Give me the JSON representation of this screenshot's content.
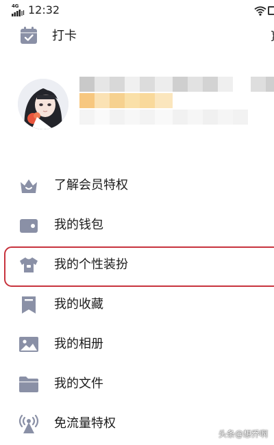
{
  "status_bar": {
    "network_label": "4G",
    "time": "12:32",
    "icons": [
      "signal-icon",
      "wifi-icon",
      "battery-icon"
    ]
  },
  "checkin": {
    "label": "打卡",
    "icon": "calendar-check-icon"
  },
  "profile": {
    "avatar": "avatar-anime-girl",
    "name_obscured": true
  },
  "menu": {
    "items": [
      {
        "label": "了解会员特权",
        "icon": "crown-icon"
      },
      {
        "label": "我的钱包",
        "icon": "wallet-icon"
      },
      {
        "label": "我的个性装扮",
        "icon": "shirt-icon",
        "highlighted": true
      },
      {
        "label": "我的收藏",
        "icon": "bookmark-icon"
      },
      {
        "label": "我的相册",
        "icon": "image-icon"
      },
      {
        "label": "我的文件",
        "icon": "folder-icon"
      },
      {
        "label": "免流量特权",
        "icon": "broadcast-icon"
      }
    ]
  },
  "colors": {
    "icon_gray": "#8a90a6",
    "highlight_border": "#c7323c",
    "text": "#1b1b1b"
  },
  "watermark": "头条@想乔啊"
}
